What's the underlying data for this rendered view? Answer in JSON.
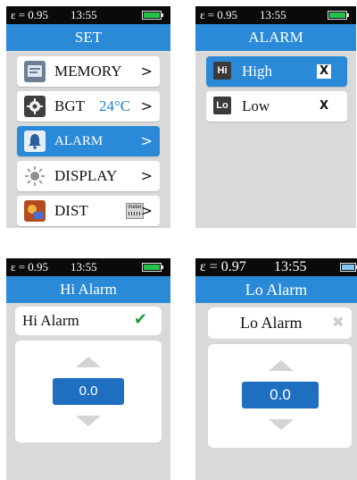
{
  "colors": {
    "accent": "#2b8ad8",
    "value_box": "#1f6fc0",
    "status_bar": "#0a0a0a",
    "battery_green": "#24c24a",
    "battery_blue": "#7fc7f7",
    "check_green": "#1e9a3a"
  },
  "screens": {
    "set": {
      "status": {
        "emissivity": "ε = 0.95",
        "time": "13:55",
        "battery_icon": "battery-full-icon"
      },
      "title": "SET",
      "items": [
        {
          "label": "MEMORY",
          "icon": "memory-icon",
          "chevron": ">"
        },
        {
          "label": "BGT",
          "value": "24°C",
          "icon": "gear-icon",
          "chevron": ">"
        },
        {
          "label": "ALARM",
          "icon": "bell-icon",
          "chevron": ">",
          "selected": true
        },
        {
          "label": "DISPLAY",
          "icon": "brightness-icon",
          "chevron": ">"
        },
        {
          "label": "DIST",
          "icon": "distance-icon",
          "badge": "meter",
          "chevron": ">"
        }
      ]
    },
    "alarm": {
      "status": {
        "emissivity": "ε = 0.95",
        "time": "13:55",
        "battery_icon": "battery-full-icon"
      },
      "title": "ALARM",
      "items": [
        {
          "tag": "Hi",
          "label": "High",
          "mark": "X",
          "selected": true
        },
        {
          "tag": "Lo",
          "label": "Low",
          "mark": "X"
        }
      ]
    },
    "hi_alarm": {
      "status": {
        "emissivity": "ε = 0.95",
        "time": "13:55",
        "battery_icon": "battery-full-icon"
      },
      "title": "Hi Alarm",
      "toggle_label": "Hi Alarm",
      "toggle_mark": "✔",
      "value": "0.0"
    },
    "lo_alarm": {
      "status": {
        "emissivity": "ε = 0.97",
        "time": "13:55",
        "battery_icon": "battery-full-icon"
      },
      "title": "Lo Alarm",
      "toggle_label": "Lo Alarm",
      "toggle_mark": "✖",
      "value": "0.0"
    }
  }
}
